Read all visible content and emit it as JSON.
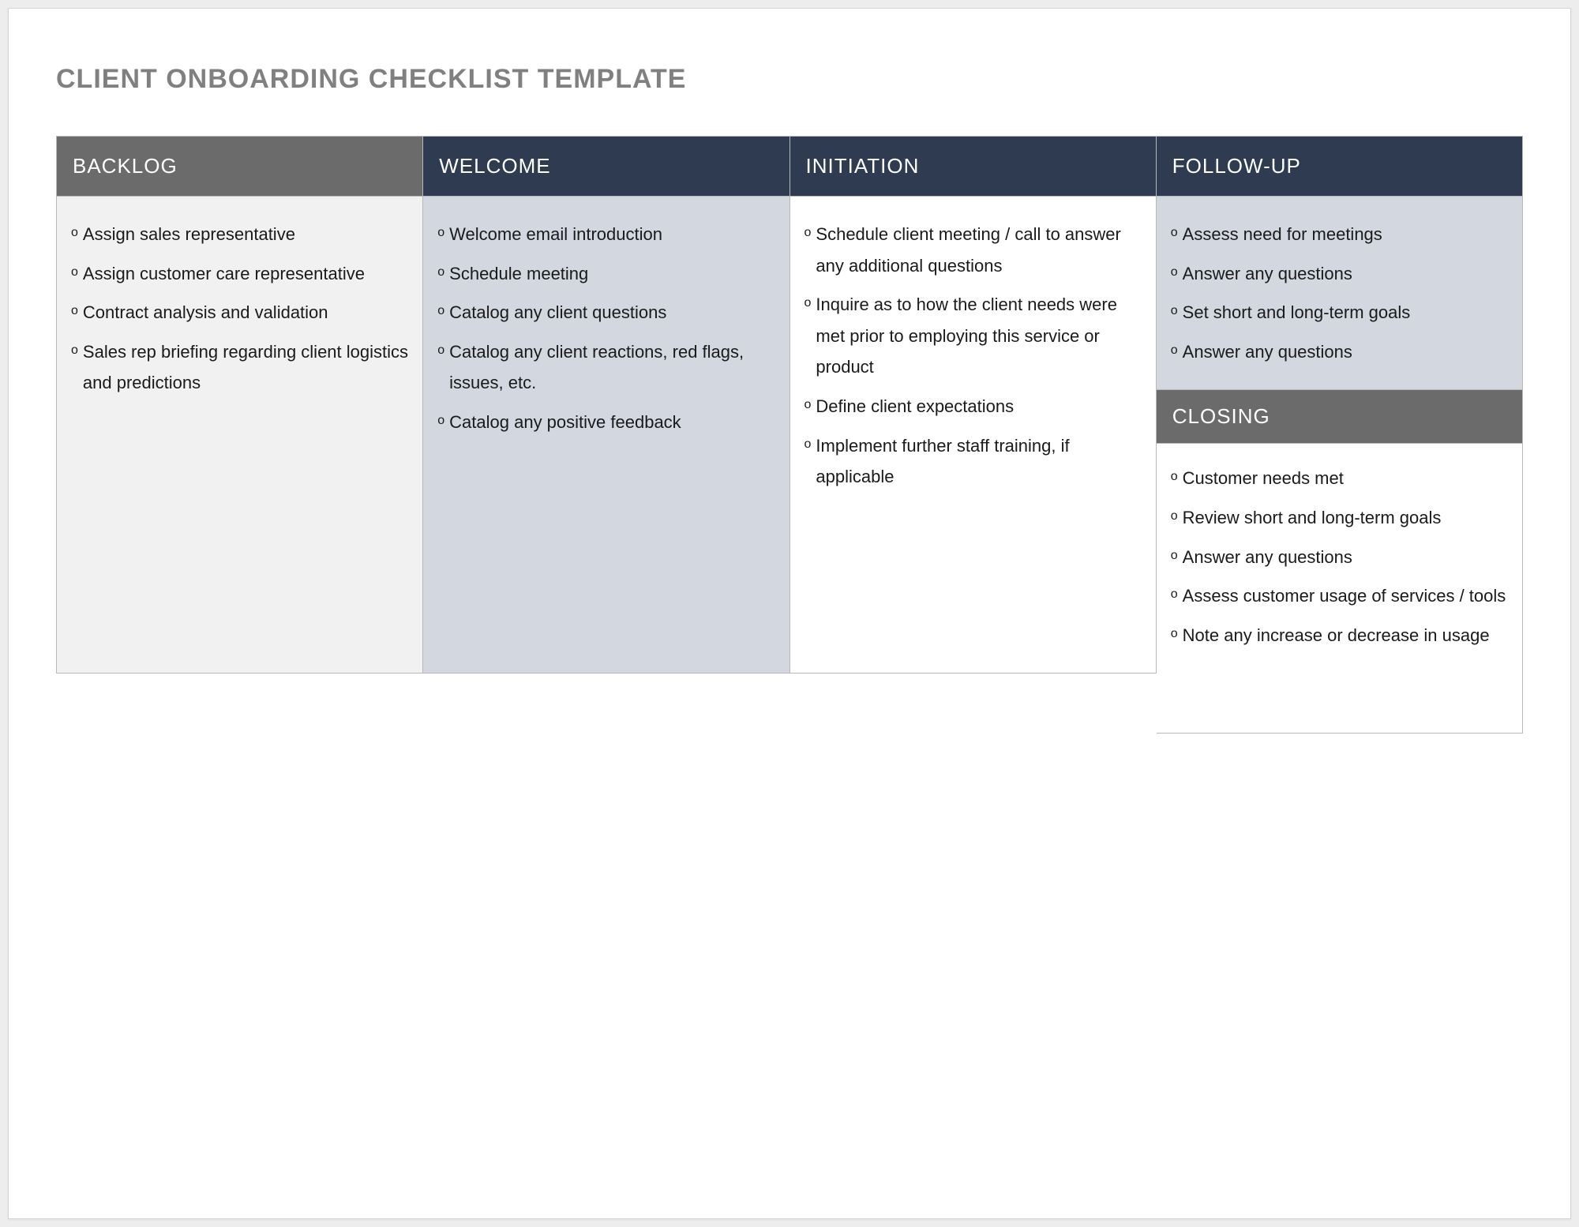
{
  "title": "CLIENT ONBOARDING CHECKLIST TEMPLATE",
  "columns": {
    "backlog": {
      "header": "BACKLOG",
      "items": [
        "Assign sales representative",
        "Assign customer care representative",
        "Contract analysis and validation",
        "Sales rep briefing regarding client logistics and predictions"
      ]
    },
    "welcome": {
      "header": "WELCOME",
      "items": [
        "Welcome email introduction",
        "Schedule meeting",
        "Catalog any client questions",
        "Catalog any client reactions, red flags, issues, etc.",
        "Catalog any positive feedback"
      ]
    },
    "initiation": {
      "header": "INITIATION",
      "items": [
        "Schedule client meeting / call to answer any additional questions",
        "Inquire as to how the client needs were met prior to employing this service or product",
        "Define client expectations",
        "Implement further staff training, if applicable"
      ]
    },
    "followup": {
      "header": "FOLLOW-UP",
      "items": [
        "Assess need for meetings",
        "Answer any questions",
        "Set short and long-term goals",
        "Answer any questions"
      ]
    },
    "closing": {
      "header": "CLOSING",
      "items": [
        "Customer needs met",
        "Review short and long-term goals",
        "Answer any questions",
        "Assess customer usage of services / tools",
        "Note any increase or decrease in usage"
      ]
    }
  }
}
